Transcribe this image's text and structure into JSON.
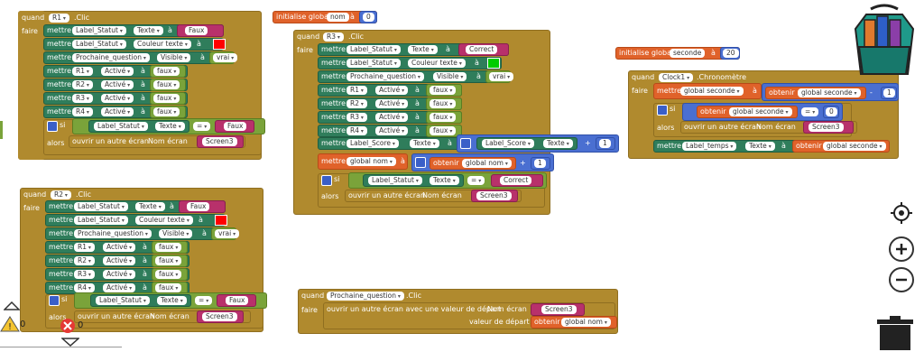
{
  "kw": {
    "when": "quand",
    "do": "faire",
    "set": "mettre",
    "to": "à",
    "if": "si",
    "then": "alors",
    "init": "initialise global",
    "get": "obtenir",
    "open": "ouvrir un autre écran",
    "screen_name": "Nom écran",
    "open_start": "ouvrir un autre écran avec une valeur de départ",
    "start_val": "valeur de départ"
  },
  "c": {
    "r1": "R1",
    "r2": "R2",
    "r3": "R3",
    "r4": "R4",
    "lbl_statut": "Label_Statut",
    "lbl_score": "Label_Score",
    "lbl_temps": "Label_temps",
    "prochaine": "Prochaine_question",
    "clock1": "Clock1"
  },
  "p": {
    "texte": "Texte",
    "couleur": "Couleur texte",
    "visible": "Visible",
    "active": "Activé",
    "clic": ".Clic",
    "chrono": ".Chronomètre"
  },
  "v": {
    "faux": "Faux",
    "vrai": "vrai",
    "false": "faux",
    "correct": "Correct",
    "screen3": "Screen3",
    "eq": "=",
    "plus": "+",
    "minus": "-",
    "one": "1",
    "zero": "0",
    "twenty": "20",
    "nom": "nom",
    "seconde": "seconde",
    "g_nom": "global nom",
    "g_seconde": "global seconde"
  },
  "ws": {
    "warnings": "0",
    "errors": "0"
  },
  "colors": {
    "red": "#ff0000",
    "green": "#00cc00"
  }
}
